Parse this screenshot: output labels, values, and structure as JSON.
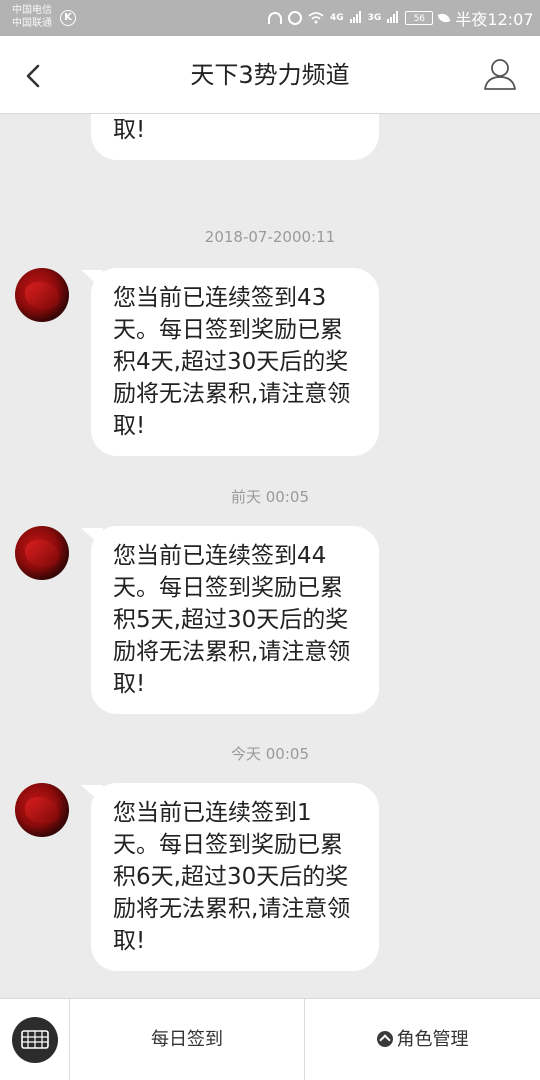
{
  "status_bar": {
    "carrier1": "中国电信",
    "carrier2": "中国联通",
    "carrier_icon": "K",
    "network1": "4G",
    "network2": "3G",
    "battery": "56",
    "time": "半夜12:07"
  },
  "header": {
    "title": "天下3势力频道"
  },
  "messages": [
    {
      "timestamp": "",
      "text": "将无法累积,请注意领取!"
    },
    {
      "timestamp": "2018-07-2000:11",
      "text": "您当前已连续签到43天。每日签到奖励已累积4天,超过30天后的奖励将无法累积,请注意领取!"
    },
    {
      "timestamp": "前天 00:05",
      "text": "您当前已连续签到44天。每日签到奖励已累积5天,超过30天后的奖励将无法累积,请注意领取!"
    },
    {
      "timestamp": "今天 00:05",
      "text": "您当前已连续签到1天。每日签到奖励已累积6天,超过30天后的奖励将无法累积,请注意领取!"
    }
  ],
  "bottom_bar": {
    "item1": "每日签到",
    "item2": "角色管理"
  },
  "icons": {
    "back": "chevron-left-icon",
    "profile": "user-icon",
    "keyboard": "keyboard-icon",
    "expand": "chevron-up-circle-icon"
  }
}
